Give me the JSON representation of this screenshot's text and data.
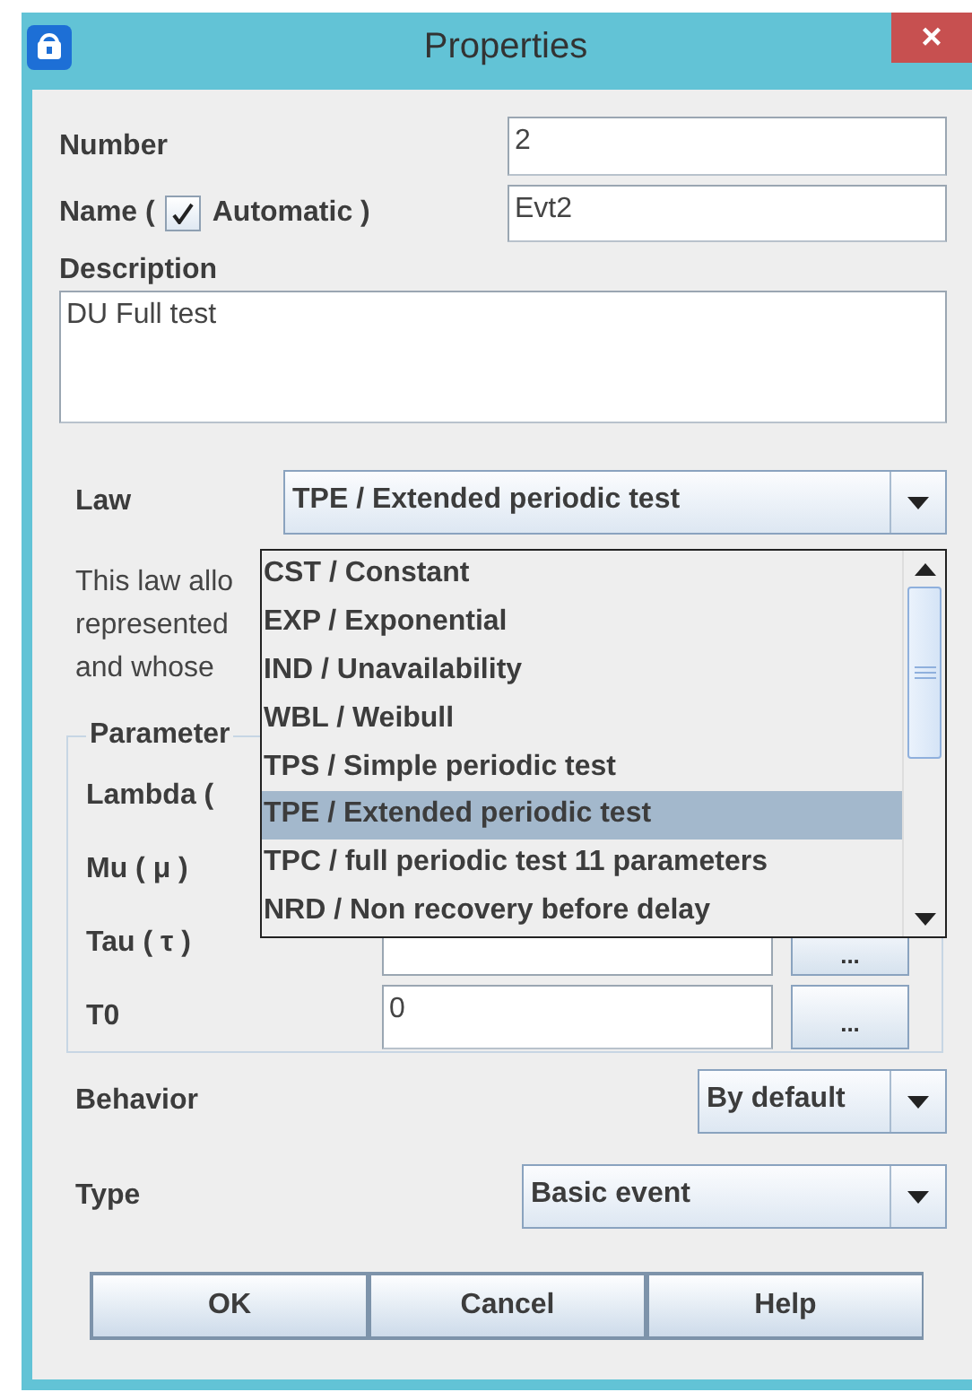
{
  "window": {
    "title": "Properties",
    "close": "×"
  },
  "number": {
    "label": "Number",
    "value": "2"
  },
  "name": {
    "label_start": "Name (",
    "automatic": {
      "label": "Automatic )",
      "checked": true
    },
    "value": "Evt2"
  },
  "description": {
    "label": "Description",
    "value": "DU Full test"
  },
  "law": {
    "label": "Law",
    "value": "TPE / Extended periodic test",
    "expanded": true,
    "options": [
      {
        "label": "CST / Constant",
        "selected": false
      },
      {
        "label": "EXP / Exponential",
        "selected": false
      },
      {
        "label": "IND / Unavailability",
        "selected": false
      },
      {
        "label": "WBL / Weibull",
        "selected": false
      },
      {
        "label": "TPS / Simple periodic test",
        "selected": false
      },
      {
        "label": "TPE / Extended periodic test",
        "selected": true
      },
      {
        "label": "TPC / full periodic test 11 parameters",
        "selected": false
      },
      {
        "label": "NRD / Non recovery before delay",
        "selected": false
      }
    ]
  },
  "law_help": [
    "This law allo",
    "represented",
    "and whose"
  ],
  "parameters": {
    "title": "Parameter",
    "rows": [
      {
        "label": "Lambda (",
        "kind": "covered"
      },
      {
        "label": "Mu ( μ )",
        "kind": "covered"
      },
      {
        "label": "Tau ( τ )",
        "kind": "clipped",
        "button": "..."
      },
      {
        "label": "T0",
        "kind": "field",
        "value": "0",
        "button": "..."
      }
    ]
  },
  "behavior": {
    "label": "Behavior",
    "value": "By default"
  },
  "type": {
    "label": "Type",
    "value": "Basic event"
  },
  "buttons": [
    "OK",
    "Cancel",
    "Help"
  ]
}
